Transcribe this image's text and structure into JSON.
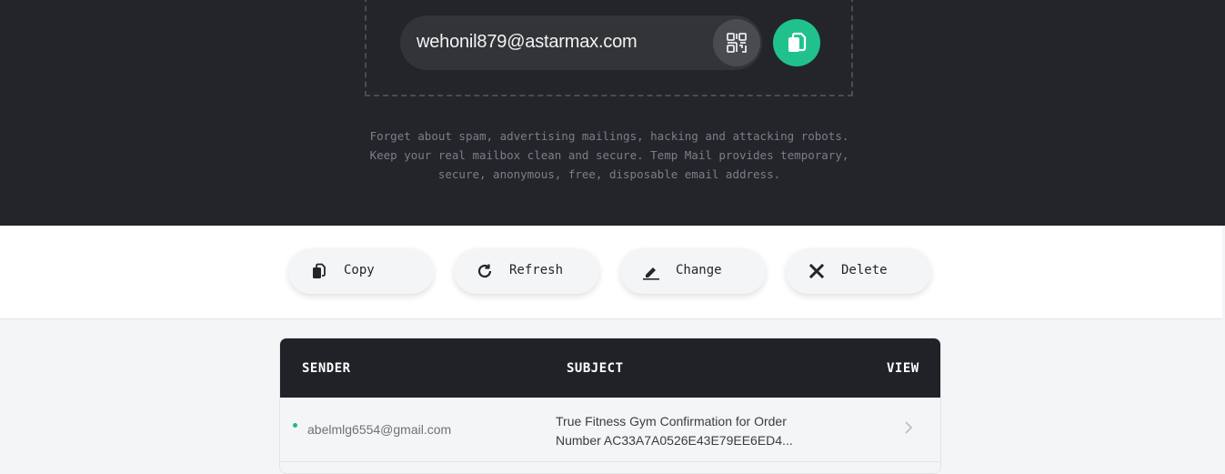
{
  "hero": {
    "email": "wehonil879@astarmax.com",
    "description_lines": [
      "Forget about spam, advertising mailings, hacking and attacking robots.",
      "Keep your real mailbox clean and secure. Temp Mail provides temporary,",
      "secure, anonymous, free, disposable email address."
    ],
    "icons": {
      "qr": "qr-code-icon",
      "copy": "copy-icon"
    },
    "colors": {
      "background": "#24252b",
      "accent": "#21c18d"
    }
  },
  "actions": [
    {
      "label": "Copy",
      "icon": "copy-icon"
    },
    {
      "label": "Refresh",
      "icon": "refresh-icon"
    },
    {
      "label": "Change",
      "icon": "edit-icon"
    },
    {
      "label": "Delete",
      "icon": "close-icon"
    }
  ],
  "inbox": {
    "columns": {
      "sender": "SENDER",
      "subject": "SUBJECT",
      "view": "VIEW"
    },
    "rows": [
      {
        "sender": "abelmlg6554@gmail.com",
        "subject_line1": "True Fitness Gym Confirmation for Order",
        "subject_line2": "Number AC33A7A0526E43E79EE6ED4...",
        "unread": true
      }
    ]
  }
}
